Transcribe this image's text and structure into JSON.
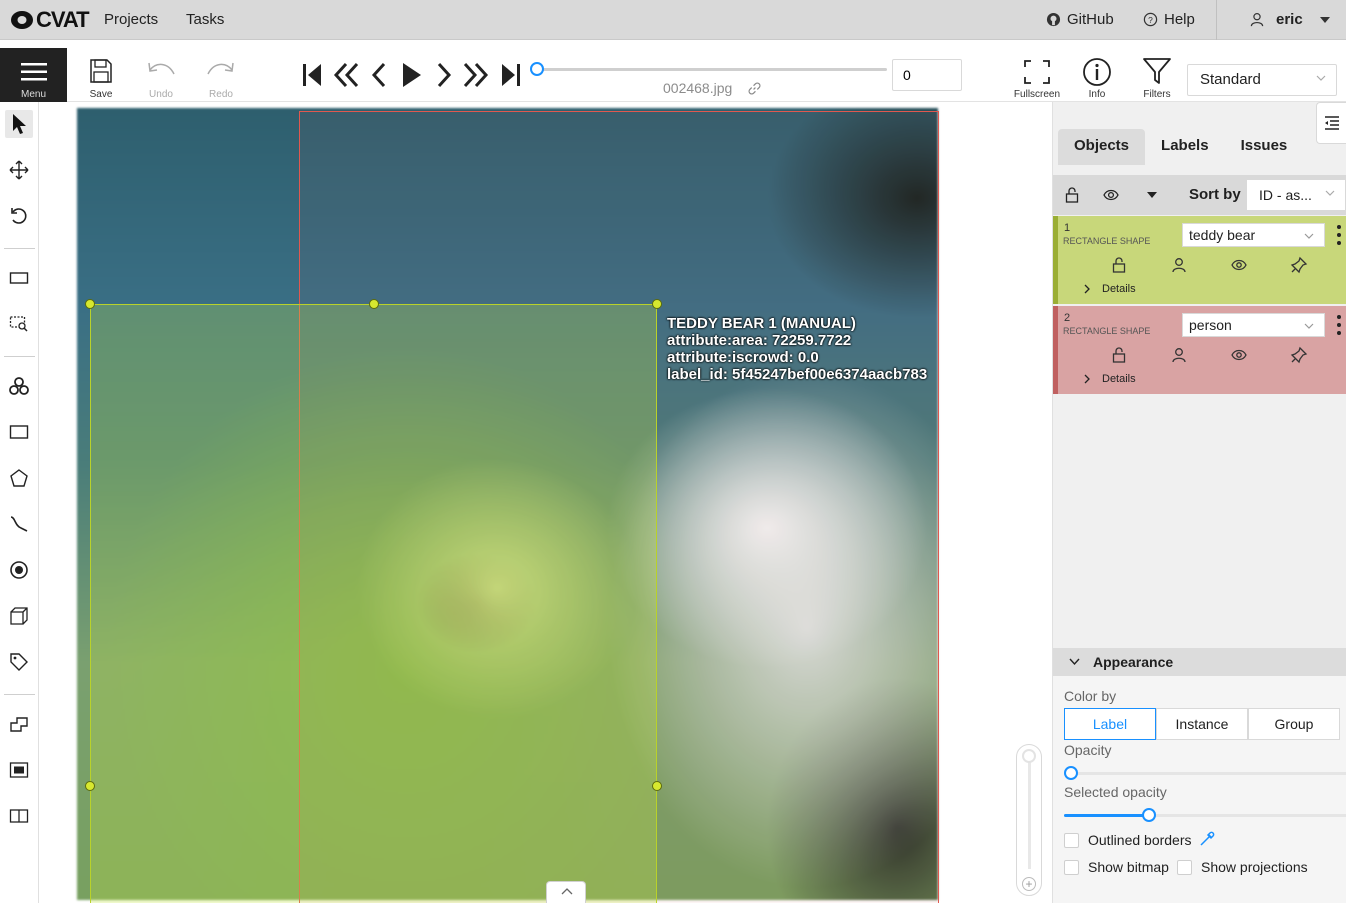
{
  "header": {
    "logo": "CVAT",
    "nav": [
      "Projects",
      "Tasks"
    ],
    "github": "GitHub",
    "help": "Help",
    "user": "eric"
  },
  "toolbar": {
    "menu_label": "Menu",
    "save_label": "Save",
    "undo_label": "Undo",
    "redo_label": "Redo",
    "filename": "002468.jpg",
    "frame_number": "0",
    "fullscreen_label": "Fullscreen",
    "info_label": "Info",
    "filters_label": "Filters",
    "workspace": "Standard"
  },
  "canvas": {
    "label_lines": [
      "TEDDY BEAR 1 (MANUAL)",
      "attribute:area: 72259.7722",
      "attribute:iscrowd: 0.0",
      "label_id: 5f45247bef00e6374aacb783"
    ]
  },
  "sidebar": {
    "tabs": [
      "Objects",
      "Labels",
      "Issues"
    ],
    "sort_by_label": "Sort by",
    "sort_value": "ID - as...",
    "objects": [
      {
        "id": "1",
        "type": "RECTANGLE SHAPE",
        "label": "teddy bear",
        "details": "Details",
        "color": "#c8d77a",
        "border": "#9aae35"
      },
      {
        "id": "2",
        "type": "RECTANGLE SHAPE",
        "label": "person",
        "details": "Details",
        "color": "#d9a3a3",
        "border": "#c06060"
      }
    ],
    "appearance": {
      "title": "Appearance",
      "color_by_label": "Color by",
      "color_by_options": [
        "Label",
        "Instance",
        "Group"
      ],
      "color_by_selected": "Label",
      "opacity_label": "Opacity",
      "opacity_value": 0.0,
      "selected_opacity_label": "Selected opacity",
      "selected_opacity_value": 0.3,
      "outlined_borders": "Outlined borders",
      "show_bitmap": "Show bitmap",
      "show_projections": "Show projections"
    }
  },
  "colors": {
    "accent": "#1890ff",
    "teddy_bear_box": "#b9d22a",
    "person_box": "#e0584f"
  }
}
